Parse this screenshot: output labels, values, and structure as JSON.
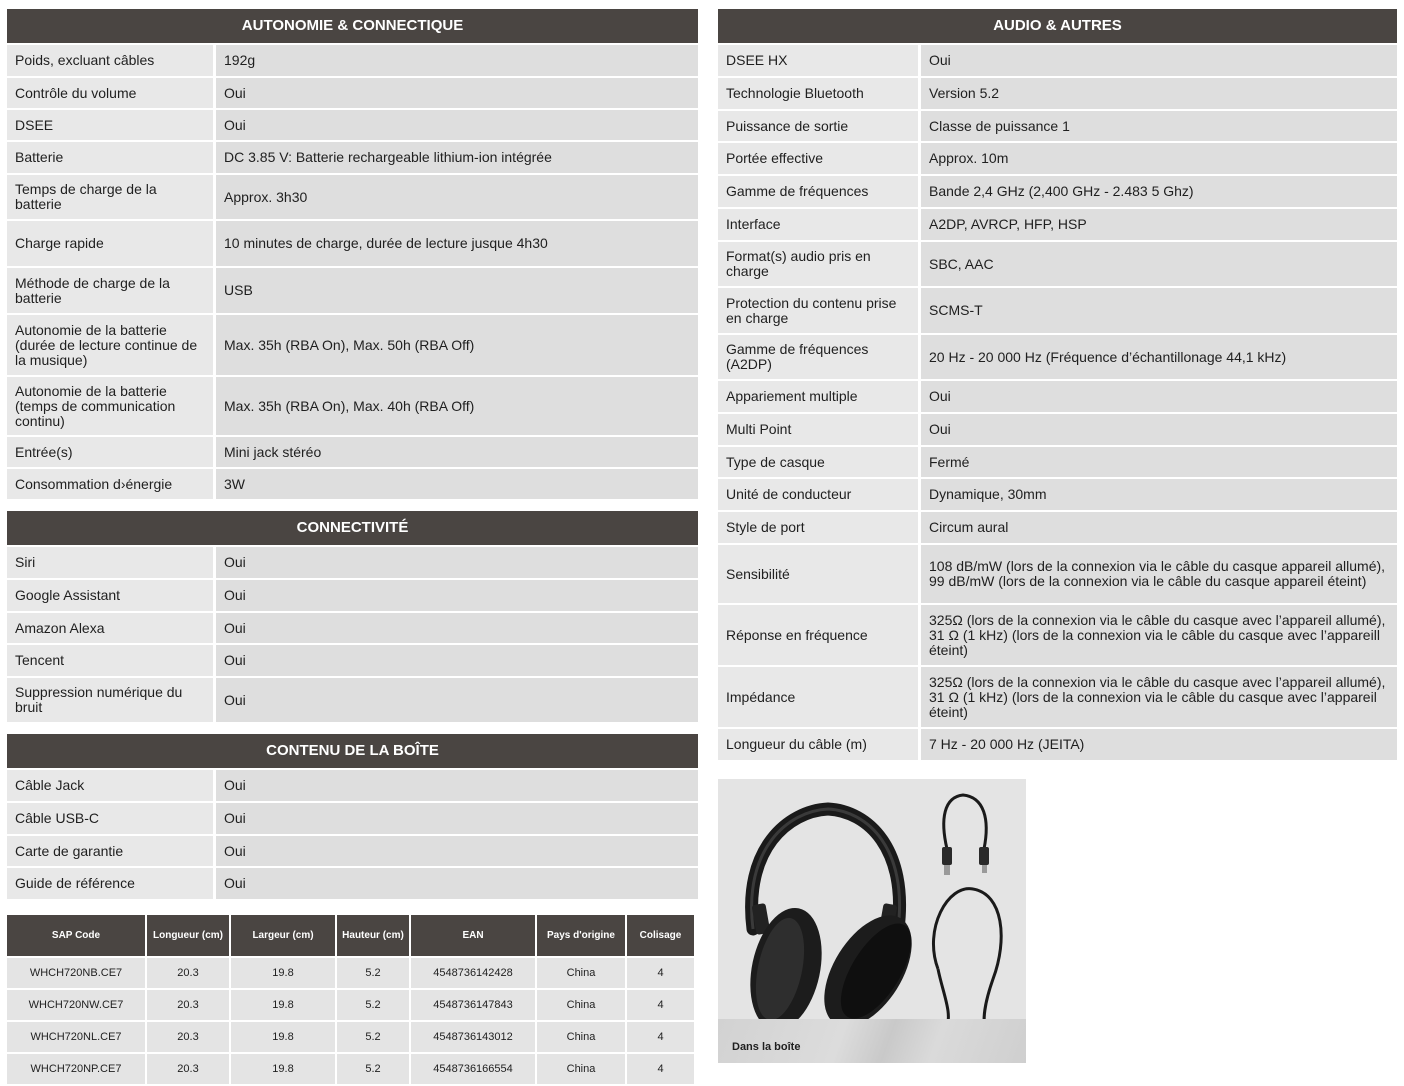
{
  "autonomie": {
    "title": "AUTONOMIE & CONNECTIQUE",
    "rows": [
      {
        "k": "Poids, excluant câbles",
        "v": "192g"
      },
      {
        "k": "Contrôle du volume",
        "v": "Oui"
      },
      {
        "k": "DSEE",
        "v": "Oui"
      },
      {
        "k": "Batterie",
        "v": "DC 3.85 V: Batterie rechargeable lithium-ion intégrée"
      },
      {
        "k": "Temps de charge de la batterie",
        "v": "Approx. 3h30"
      },
      {
        "k": "Charge rapide",
        "v": "10 minutes de charge, durée de lecture jusque 4h30"
      },
      {
        "k": "Méthode de charge de la batterie",
        "v": "USB"
      },
      {
        "k": "Autonomie de la batterie (durée de lecture continue de la musique)",
        "v": "Max. 35h (RBA On), Max. 50h (RBA Off)"
      },
      {
        "k": "Autonomie de la batterie (temps de communication continu)",
        "v": "Max. 35h (RBA On), Max. 40h (RBA Off)"
      },
      {
        "k": "Entrée(s)",
        "v": "Mini jack stéréo"
      },
      {
        "k": "Consommation d›énergie",
        "v": "3W"
      }
    ]
  },
  "connectivite": {
    "title": "CONNECTIVITÉ",
    "rows": [
      {
        "k": "Siri",
        "v": "Oui"
      },
      {
        "k": "Google Assistant",
        "v": "Oui"
      },
      {
        "k": "Amazon Alexa",
        "v": "Oui"
      },
      {
        "k": "Tencent",
        "v": "Oui"
      },
      {
        "k": "Suppression numérique du bruit",
        "v": "Oui"
      }
    ]
  },
  "contenu": {
    "title": "CONTENU DE LA BOÎTE",
    "rows": [
      {
        "k": "Câble Jack",
        "v": "Oui"
      },
      {
        "k": "Câble USB-C",
        "v": "Oui"
      },
      {
        "k": "Carte de garantie",
        "v": "Oui"
      },
      {
        "k": "Guide de référence",
        "v": "Oui"
      }
    ]
  },
  "sap": {
    "headers": [
      "SAP Code",
      "Longueur (cm)",
      "Largeur (cm)",
      "Hauteur (cm)",
      "EAN",
      "Pays d'origine",
      "Colisage"
    ],
    "rows": [
      [
        "WHCH720NB.CE7",
        "20.3",
        "19.8",
        "5.2",
        "4548736142428",
        "China",
        "4"
      ],
      [
        "WHCH720NW.CE7",
        "20.3",
        "19.8",
        "5.2",
        "4548736147843",
        "China",
        "4"
      ],
      [
        "WHCH720NL.CE7",
        "20.3",
        "19.8",
        "5.2",
        "4548736143012",
        "China",
        "4"
      ],
      [
        "WHCH720NP.CE7",
        "20.3",
        "19.8",
        "5.2",
        "4548736166554",
        "China",
        "4"
      ]
    ]
  },
  "audio": {
    "title": "AUDIO & AUTRES",
    "rows": [
      {
        "k": "DSEE HX",
        "v": "Oui"
      },
      {
        "k": "Technologie Bluetooth",
        "v": "Version 5.2"
      },
      {
        "k": "Puissance de sortie",
        "v": "Classe de puissance 1"
      },
      {
        "k": "Portée effective",
        "v": "Approx. 10m"
      },
      {
        "k": "Gamme de fréquences",
        "v": "Bande 2,4 GHz (2,400 GHz - 2.483 5 Ghz)"
      },
      {
        "k": "Interface",
        "v": "A2DP, AVRCP, HFP, HSP"
      },
      {
        "k": "Format(s) audio pris en charge",
        "v": "SBC, AAC"
      },
      {
        "k": "Protection du contenu prise en charge",
        "v": "SCMS-T"
      },
      {
        "k": "Gamme de fréquences (A2DP)",
        "v": "20 Hz - 20 000 Hz (Fréquence d’échantillonage 44,1 kHz)"
      },
      {
        "k": "Appariement multiple",
        "v": "Oui"
      },
      {
        "k": "Multi Point",
        "v": "Oui"
      },
      {
        "k": "Type de casque",
        "v": "Fermé"
      },
      {
        "k": "Unité de conducteur",
        "v": "Dynamique, 30mm"
      },
      {
        "k": "Style de port",
        "v": "Circum aural"
      },
      {
        "k": "Sensibilité",
        "v": "108 dB/mW (lors de la connexion via le câble du casque appareil allumé), 99 dB/mW (lors de la connexion via le câble du casque appareil éteint)"
      },
      {
        "k": "Réponse en fréquence",
        "v": "325Ω (lors de la connexion via le câble du casque avec l’appareil allumé), 31 Ω (1 kHz) (lors de la connexion via le câble du casque avec l’appareill éteint)"
      },
      {
        "k": "Impédance",
        "v": "325Ω (lors de la connexion via le câble du casque avec l’appareil allumé), 31 Ω (1 kHz) (lors de la connexion via le câble du casque avec l’appareil éteint)"
      },
      {
        "k": "Longueur du câble (m)",
        "v": "7 Hz - 20 000 Hz (JEITA)"
      }
    ]
  },
  "photo": {
    "caption": "Dans la boîte",
    "icons": [
      "headphones-icon",
      "usb-c-cable-icon",
      "audio-jack-cable-icon"
    ]
  }
}
